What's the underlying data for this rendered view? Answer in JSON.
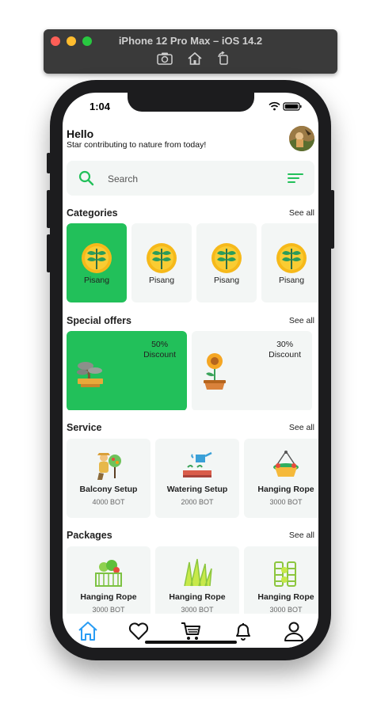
{
  "simulator": {
    "title": "iPhone 12 Pro Max – iOS 14.2"
  },
  "status_bar": {
    "time": "1:04"
  },
  "header": {
    "title": "Hello",
    "subtitle": "Star contributing to nature from today!"
  },
  "search": {
    "placeholder": "Search"
  },
  "categories": {
    "title": "Categories",
    "see_all": "See all",
    "items": [
      {
        "label": "Pisang"
      },
      {
        "label": "Pisang"
      },
      {
        "label": "Pisang"
      },
      {
        "label": "Pisang"
      }
    ]
  },
  "offers": {
    "title": "Special offers",
    "see_all": "See all",
    "items": [
      {
        "percent": "50%",
        "label": "Discount"
      },
      {
        "percent": "30%",
        "label": "Discount"
      }
    ]
  },
  "service": {
    "title": "Service",
    "see_all": "See all",
    "items": [
      {
        "name": "Balcony Setup",
        "price": "4000 BOT"
      },
      {
        "name": "Watering Setup",
        "price": "2000 BOT"
      },
      {
        "name": "Hanging Rope",
        "price": "3000 BOT"
      }
    ]
  },
  "packages": {
    "title": "Packages",
    "see_all": "See all",
    "items": [
      {
        "name": "Hanging Rope",
        "price": "3000 BOT"
      },
      {
        "name": "Hanging Rope",
        "price": "3000 BOT"
      },
      {
        "name": "Hanging Rope",
        "price": "3000 BOT"
      }
    ]
  },
  "tabbar": {
    "icons": [
      "home-icon",
      "heart-icon",
      "cart-icon",
      "bell-icon",
      "user-icon"
    ]
  },
  "colors": {
    "accent": "#22c05a",
    "active_tab": "#2a9df4",
    "card_bg": "#f3f6f5"
  }
}
